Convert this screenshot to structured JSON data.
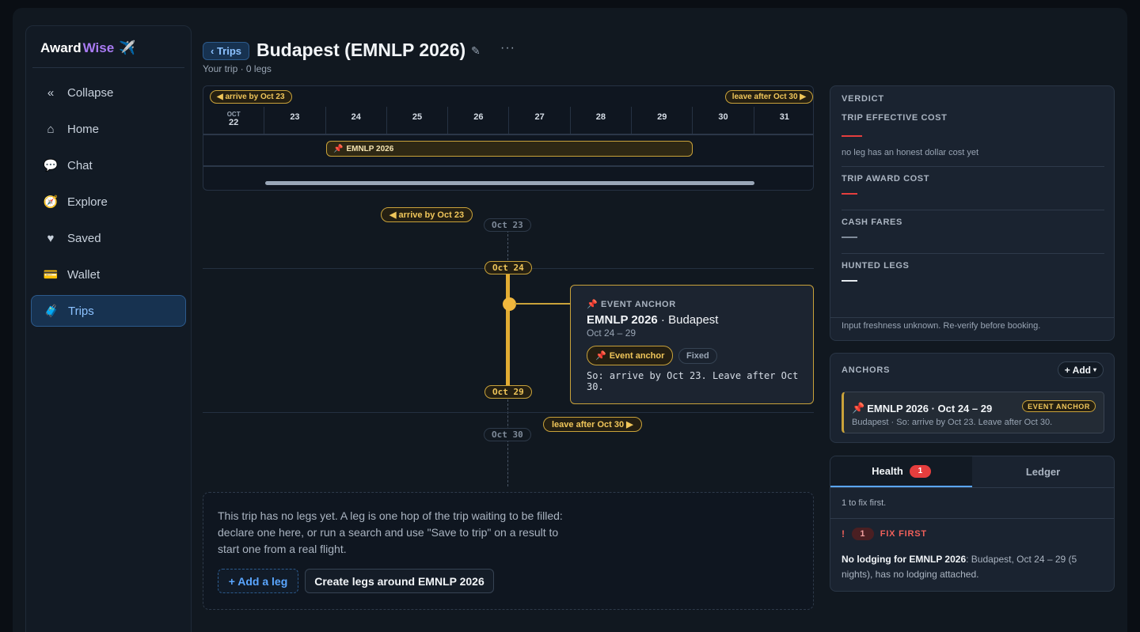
{
  "app": {
    "brand_prefix": "Award",
    "brand_suffix": "Wise",
    "brand_icon": "airplane-icon"
  },
  "sidebar": {
    "items": [
      {
        "label": "Collapse",
        "icon": "collapse-icon",
        "glyph": "«"
      },
      {
        "label": "Home",
        "icon": "home-icon",
        "glyph": "⌂"
      },
      {
        "label": "Chat",
        "icon": "chat-icon",
        "glyph": "💬"
      },
      {
        "label": "Explore",
        "icon": "compass-icon",
        "glyph": "🧭"
      },
      {
        "label": "Saved",
        "icon": "heart-icon",
        "glyph": "♥"
      },
      {
        "label": "Wallet",
        "icon": "wallet-icon",
        "glyph": "💳"
      },
      {
        "label": "Trips",
        "icon": "luggage-icon",
        "glyph": "🧳",
        "active": true
      }
    ]
  },
  "header": {
    "back_label": "‹ Trips",
    "title": "Budapest (EMNLP 2026)",
    "subtitle": "Your trip · 0 legs"
  },
  "calendar": {
    "arrive_label": "◀ arrive by Oct 23",
    "leave_label": "leave after Oct 30 ▶",
    "month": "OCT",
    "days": [
      "22",
      "23",
      "24",
      "25",
      "26",
      "27",
      "28",
      "29",
      "30",
      "31"
    ],
    "event_label": "EMNLP 2026"
  },
  "timeline": {
    "arrive_label": "◀ arrive by Oct 23",
    "leave_label": "leave after Oct 30 ▶",
    "date_oct23": "Oct 23",
    "date_oct24": "Oct 24",
    "date_oct29": "Oct 29",
    "date_oct30": "Oct 30",
    "card": {
      "kicker": "EVENT ANCHOR",
      "title_bold": "EMNLP 2026",
      "title_rest": " · Budapest",
      "dates": "Oct 24 – 29",
      "badge_anchor": "Event anchor",
      "badge_fixed": "Fixed",
      "note": "So: arrive by Oct 23. Leave after Oct 30."
    }
  },
  "empty_legs": {
    "text": "This trip has no legs yet. A leg is one hop of the trip waiting to be filled: declare one here, or run a search and use \"Save to trip\" on a result to start one from a real flight.",
    "add_leg": "+ Add a leg",
    "create_legs": "Create legs around EMNLP 2026"
  },
  "verdict": {
    "title": "VERDICT",
    "trip_effective_cost": "TRIP EFFECTIVE COST",
    "effective_note": "no leg has an honest dollar cost yet",
    "trip_award_cost": "TRIP AWARD COST",
    "cash_fares": "CASH FARES",
    "hunted_legs": "HUNTED LEGS",
    "footer": "Input freshness unknown. Re-verify before booking.",
    "colors": {
      "red": "#e53e3e",
      "gray": "#7f8b9a",
      "white": "#e6ebf0"
    }
  },
  "anchors": {
    "title": "ANCHORS",
    "add_label": "+ Add",
    "item_title": "EMNLP 2026 · Oct 24 – 29",
    "item_badge": "EVENT ANCHOR",
    "item_sub": "Budapest · So: arrive by Oct 23. Leave after Oct 30."
  },
  "health": {
    "tab_health": "Health",
    "tab_health_count": "1",
    "tab_ledger": "Ledger",
    "summary": "1 to fix first.",
    "fix_bang": "!",
    "fix_count": "1",
    "fix_label": "FIX FIRST",
    "msg_bold": "No lodging for EMNLP 2026",
    "msg_rest": ": Budapest, Oct 24 – 29 (5 nights), has no lodging attached."
  }
}
